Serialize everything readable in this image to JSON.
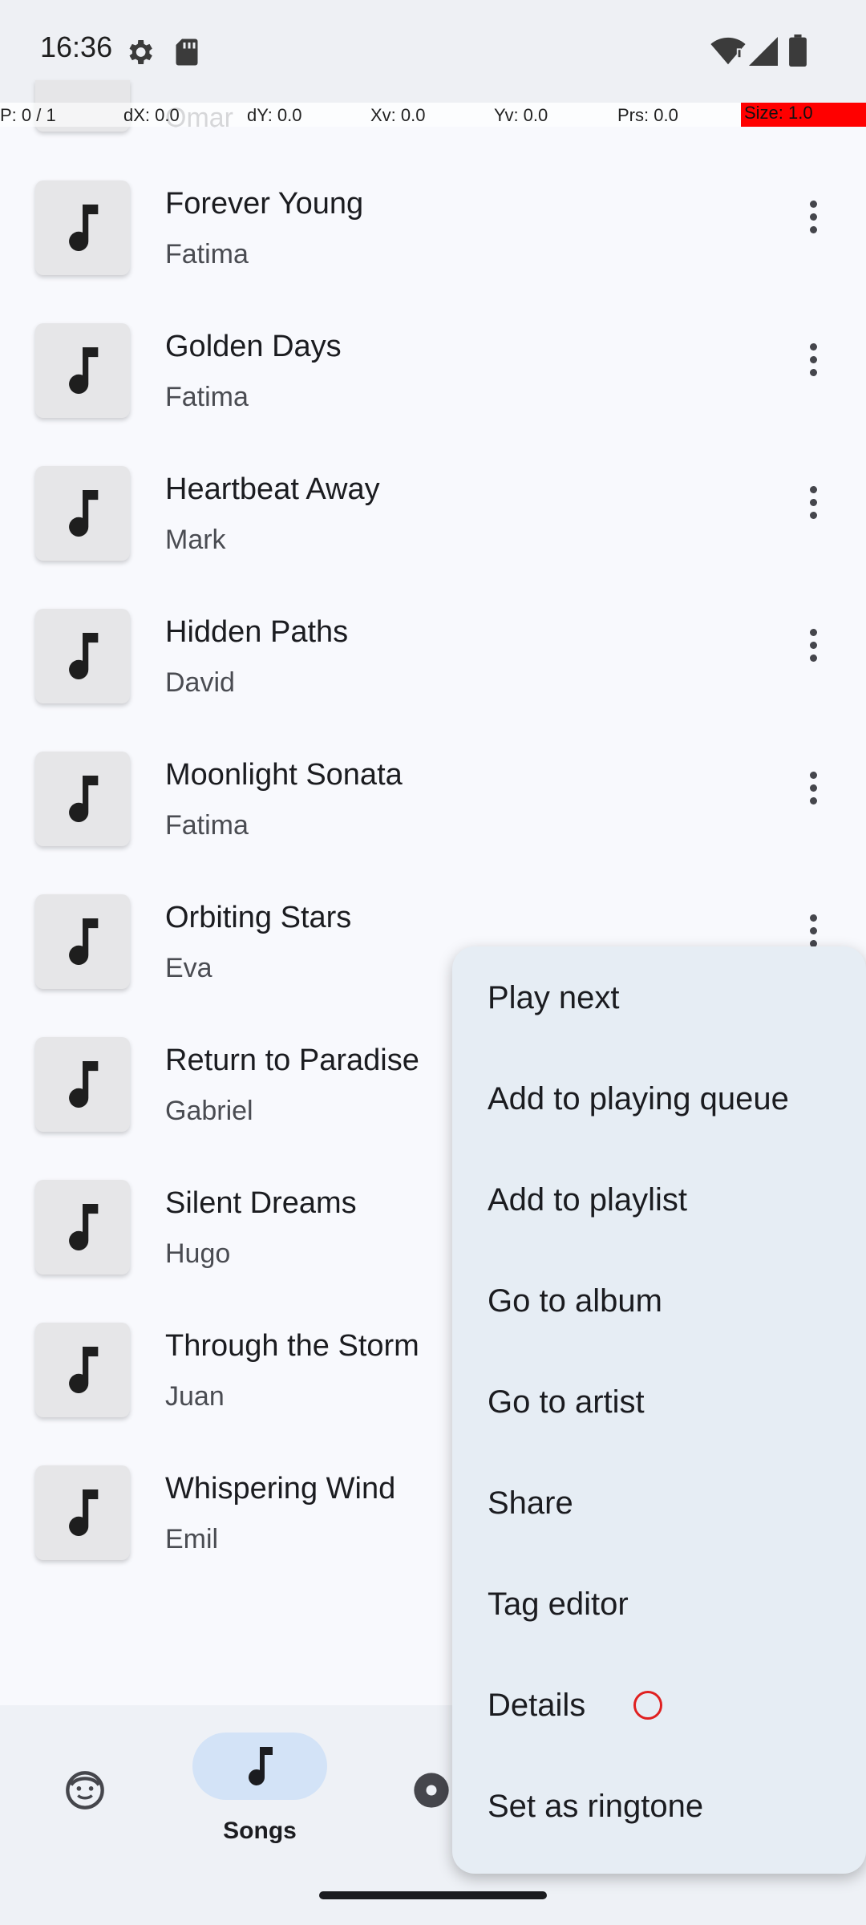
{
  "status_bar": {
    "time": "16:36"
  },
  "debug_overlay": {
    "p": "P: 0 / 1",
    "dx": "dX: 0.0",
    "dy": "dY: 0.0",
    "xv": "Xv: 0.0",
    "yv": "Yv: 0.0",
    "prs": "Prs: 0.0",
    "size": "Size: 1.0"
  },
  "partial_row": {
    "title": "Omar"
  },
  "songs": [
    {
      "title": "Forever Young",
      "artist": "Fatima"
    },
    {
      "title": "Golden Days",
      "artist": "Fatima"
    },
    {
      "title": "Heartbeat Away",
      "artist": "Mark"
    },
    {
      "title": "Hidden Paths",
      "artist": "David"
    },
    {
      "title": "Moonlight Sonata",
      "artist": "Fatima"
    },
    {
      "title": "Orbiting Stars",
      "artist": "Eva"
    },
    {
      "title": "Return to Paradise",
      "artist": "Gabriel"
    },
    {
      "title": "Silent Dreams",
      "artist": "Hugo"
    },
    {
      "title": "Through the Storm",
      "artist": "Juan"
    },
    {
      "title": "Whispering Wind",
      "artist": "Emil"
    }
  ],
  "bottom_nav": {
    "active_label": "Songs"
  },
  "context_menu": {
    "items": [
      "Play next",
      "Add to playing queue",
      "Add to playlist",
      "Go to album",
      "Go to artist",
      "Share",
      "Tag editor",
      "Details",
      "Set as ringtone"
    ]
  },
  "colors": {
    "accent_pill": "#d3e3f7",
    "menu_bg": "#e6edf4",
    "debug_size_bg": "#ff0000"
  }
}
